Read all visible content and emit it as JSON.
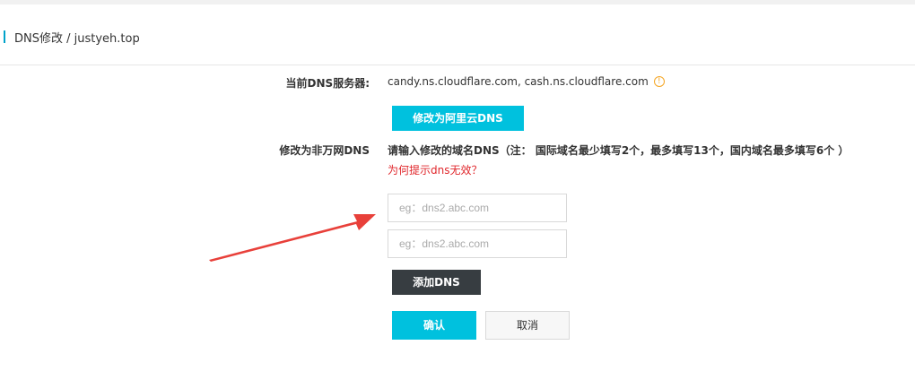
{
  "header": {
    "title": "DNS修改 / justyeh.top"
  },
  "current_dns": {
    "label": "当前DNS服务器:",
    "value": "candy.ns.cloudflare.com, cash.ns.cloudflare.com",
    "info_icon": "info-circle-icon"
  },
  "aliyun_button": {
    "label": "修改为阿里云DNS"
  },
  "non_wanwang": {
    "label": "修改为非万网DNS",
    "instruction": "请输入修改的域名DNS（注： 国际域名最少填写2个，最多填写13个，国内域名最多填写6个 ）",
    "help_link": "为何提示dns无效？"
  },
  "dns_inputs": [
    {
      "value": "",
      "placeholder": "eg：dns2.abc.com"
    },
    {
      "value": "",
      "placeholder": "eg：dns2.abc.com"
    }
  ],
  "add_dns_button": {
    "label": "添加DNS"
  },
  "actions": {
    "confirm_label": "确认",
    "cancel_label": "取消"
  },
  "colors": {
    "primary": "#00c1de",
    "dark_button": "#373d41",
    "link_red": "#e0262b",
    "info_orange": "#f5a623",
    "annotation_arrow": "#e8403a",
    "header_accent": "#00a2ca"
  }
}
